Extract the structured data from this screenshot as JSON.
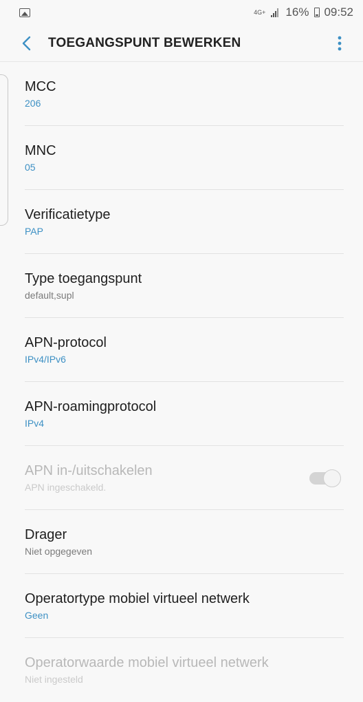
{
  "status_bar": {
    "network": "4G+",
    "battery": "16%",
    "time": "09:52"
  },
  "app_bar": {
    "title": "TOEGANGSPUNT BEWERKEN"
  },
  "settings": [
    {
      "title": "MCC",
      "value": "206"
    },
    {
      "title": "MNC",
      "value": "05"
    },
    {
      "title": "Verificatietype",
      "value": "PAP"
    },
    {
      "title": "Type toegangspunt",
      "value": "default,supl"
    },
    {
      "title": "APN-protocol",
      "value": "IPv4/IPv6"
    },
    {
      "title": "APN-roamingprotocol",
      "value": "IPv4"
    },
    {
      "title": "APN in-/uitschakelen",
      "value": "APN ingeschakeld.",
      "toggle": true,
      "toggle_on": true
    },
    {
      "title": "Drager",
      "value": "Niet opgegeven"
    },
    {
      "title": "Operatortype mobiel virtueel netwerk",
      "value": "Geen"
    },
    {
      "title": "Operatorwaarde mobiel virtueel netwerk",
      "value": "Niet ingesteld"
    }
  ],
  "colors": {
    "accent": "#3d90c4",
    "background": "#f8f8f8"
  },
  "icons": {
    "back": "back-arrow-icon",
    "more": "more-vertical-icon",
    "gallery": "gallery-icon",
    "signal": "signal-icon",
    "battery": "battery-icon"
  }
}
